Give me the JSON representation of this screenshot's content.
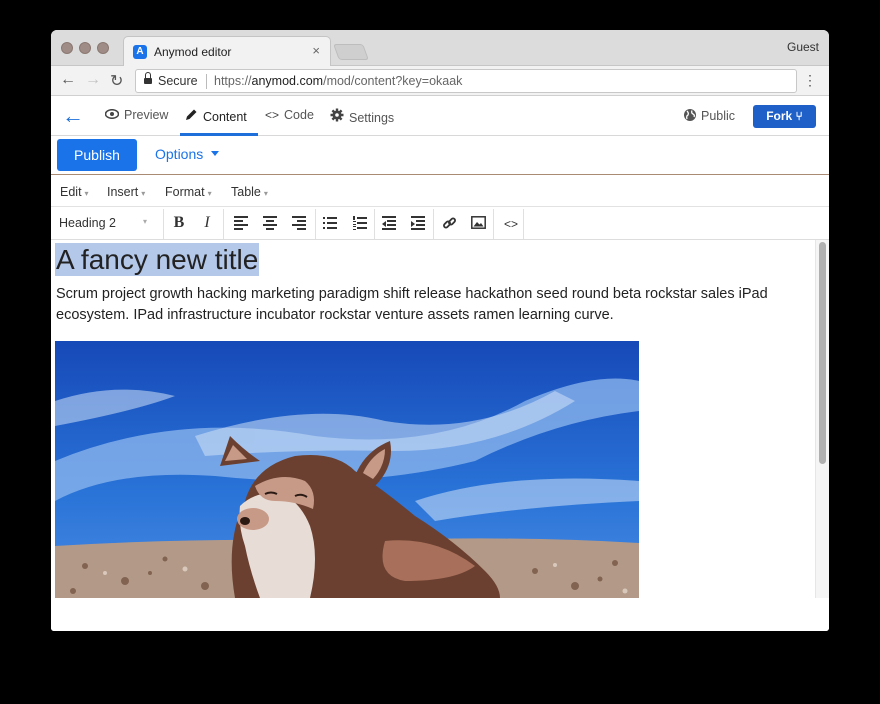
{
  "browser": {
    "tab_title": "Anymod editor",
    "tab_close": "×",
    "profile": "Guest",
    "secure_label": "Secure",
    "url_scheme": "https://",
    "url_host": "anymod.com",
    "url_path": "/mod/content?key=okaak",
    "back": "←",
    "forward": "→",
    "reload": "↻",
    "menu": "⋮"
  },
  "appnav": {
    "back_icon": "←",
    "tabs": [
      {
        "label": "Preview",
        "icon": "eye-icon",
        "glyph": "👁"
      },
      {
        "label": "Content",
        "icon": "pencil-icon",
        "glyph": "✎"
      },
      {
        "label": "Code",
        "icon": "code-icon",
        "glyph": "<>"
      },
      {
        "label": "Settings",
        "icon": "gear-icon",
        "glyph": "⚙"
      }
    ],
    "active_tab": "Content",
    "public_label": "Public",
    "fork_label": "Fork ⑂"
  },
  "publishbar": {
    "publish_label": "Publish",
    "options_label": "Options"
  },
  "menubar": {
    "items": [
      "Edit",
      "Insert",
      "Format",
      "Table"
    ]
  },
  "toolbar": {
    "block_format": "Heading 2",
    "bold": "B",
    "italic": "I",
    "code": "<>"
  },
  "document": {
    "title": "A fancy new title",
    "paragraph": "Scrum project growth hacking marketing paradigm shift release hackathon seed round beta rockstar sales iPad ecosystem. IPad infrastructure incubator rockstar venture assets ramen learning curve.",
    "image_subject": "corgi on beach under blue sky"
  },
  "colors": {
    "accent": "#1a73e8",
    "fork_button": "#1e5fc8",
    "selection": "#b4c8ea"
  }
}
